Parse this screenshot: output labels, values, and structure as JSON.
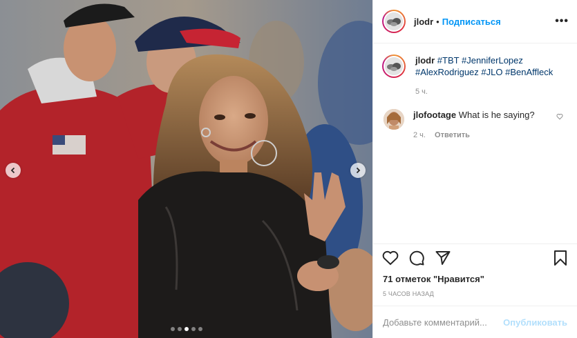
{
  "post": {
    "username": "jlodr",
    "follow_label": "Подписаться",
    "separator": "•",
    "more_label": "•••"
  },
  "caption": {
    "username": "jlodr",
    "tags": [
      "#TBT",
      "#JenniferLopez",
      "#AlexRodriguez",
      "#JLO",
      "#BenAffleck"
    ],
    "time": "5 ч."
  },
  "comment": {
    "username": "jlofootage",
    "text": "What is he saying?",
    "time": "2 ч.",
    "reply_label": "Ответить"
  },
  "likes_label": "71 отметок \"Нравится\"",
  "timestamp": "5 ЧАСОВ НАЗАД",
  "add_comment": {
    "placeholder": "Добавьте комментарий...",
    "publish_label": "Опубликовать"
  },
  "carousel": {
    "slide_count": 5,
    "active_index": 2
  },
  "colors": {
    "link": "#0095f6",
    "hashtag": "#00376b",
    "muted": "#8e8e8e",
    "publish_disabled": "#b2dffc"
  },
  "icons": [
    "chevron-left-icon",
    "chevron-right-icon",
    "heart-icon",
    "comment-icon",
    "share-icon",
    "bookmark-icon",
    "more-icon"
  ]
}
